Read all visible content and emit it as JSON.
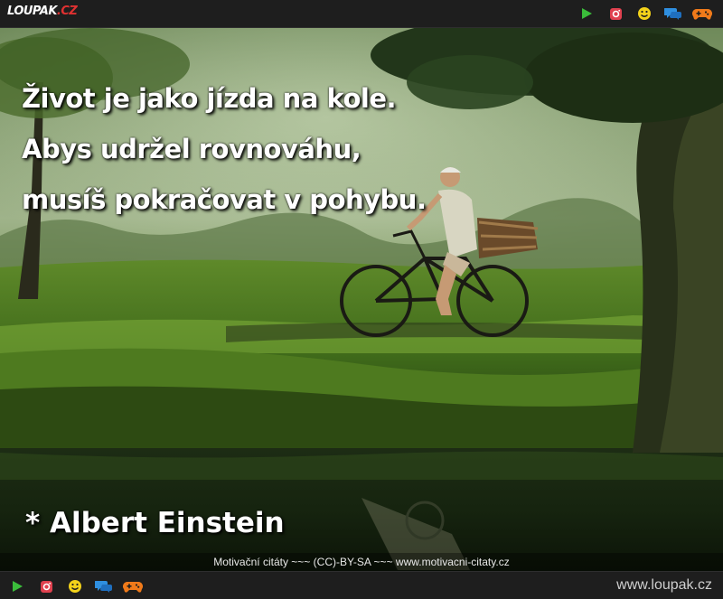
{
  "header": {
    "logo_main": "LOUPAK",
    "logo_tld": ".CZ",
    "icons": [
      "play-icon",
      "instagram-icon",
      "smiley-icon",
      "chat-icon",
      "gamepad-icon"
    ]
  },
  "image": {
    "quote_lines": [
      "Život je jako jízda na kole.",
      "Abys udržel rovnováhu,",
      "musíš pokračovat v pohybu."
    ],
    "author": "* Albert Einstein",
    "credit": "Motivační citáty ~~~ (CC)-BY-SA ~~~ www.motivacni-citaty.cz"
  },
  "footer": {
    "site_url": "www.loupak.cz",
    "icons": [
      "play-icon",
      "instagram-icon",
      "smiley-icon",
      "chat-icon",
      "gamepad-icon"
    ]
  },
  "colors": {
    "bar_bg": "#1e1e1e",
    "play": "#3bbd3b",
    "instagram": "#e0414f",
    "smiley": "#f3d21a",
    "chat": "#2f8fe0",
    "gamepad": "#f07a1a"
  }
}
